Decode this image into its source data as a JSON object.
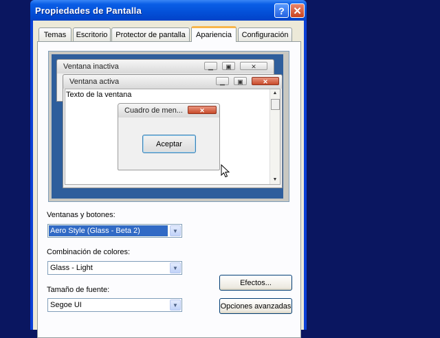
{
  "window": {
    "title": "Propiedades de Pantalla",
    "help_glyph": "?",
    "close_glyph": "✕"
  },
  "tabs": [
    {
      "label": "Temas"
    },
    {
      "label": "Escritorio"
    },
    {
      "label": "Protector de pantalla"
    },
    {
      "label": "Apariencia",
      "active": true
    },
    {
      "label": "Configuración"
    }
  ],
  "preview": {
    "inactive_title": "Ventana inactiva",
    "active_title": "Ventana activa",
    "window_text": "Texto de la ventana",
    "message_title": "Cuadro de men...",
    "message_button": "Aceptar",
    "min_glyph": "▁",
    "max_glyph": "▣",
    "close_glyph": "✕"
  },
  "form": {
    "windows_buttons_label": "Ventanas y botones:",
    "windows_buttons_value": "Aero Style (Glass - Beta 2)",
    "color_scheme_label": "Combinación de colores:",
    "color_scheme_value": "Glass - Light",
    "font_size_label": "Tamaño de fuente:",
    "font_size_value": "Segoe UI",
    "effects_button": "Efectos...",
    "advanced_button": "Opciones avanzadas"
  },
  "icons": {
    "dropdown": "chevron-down-icon",
    "cursor": "mouse-pointer-icon"
  },
  "colors": {
    "desktop": "#0a1660",
    "titlebar": "#0350d8",
    "active_tab_accent": "#f7b64a",
    "selection": "#316ac5"
  }
}
